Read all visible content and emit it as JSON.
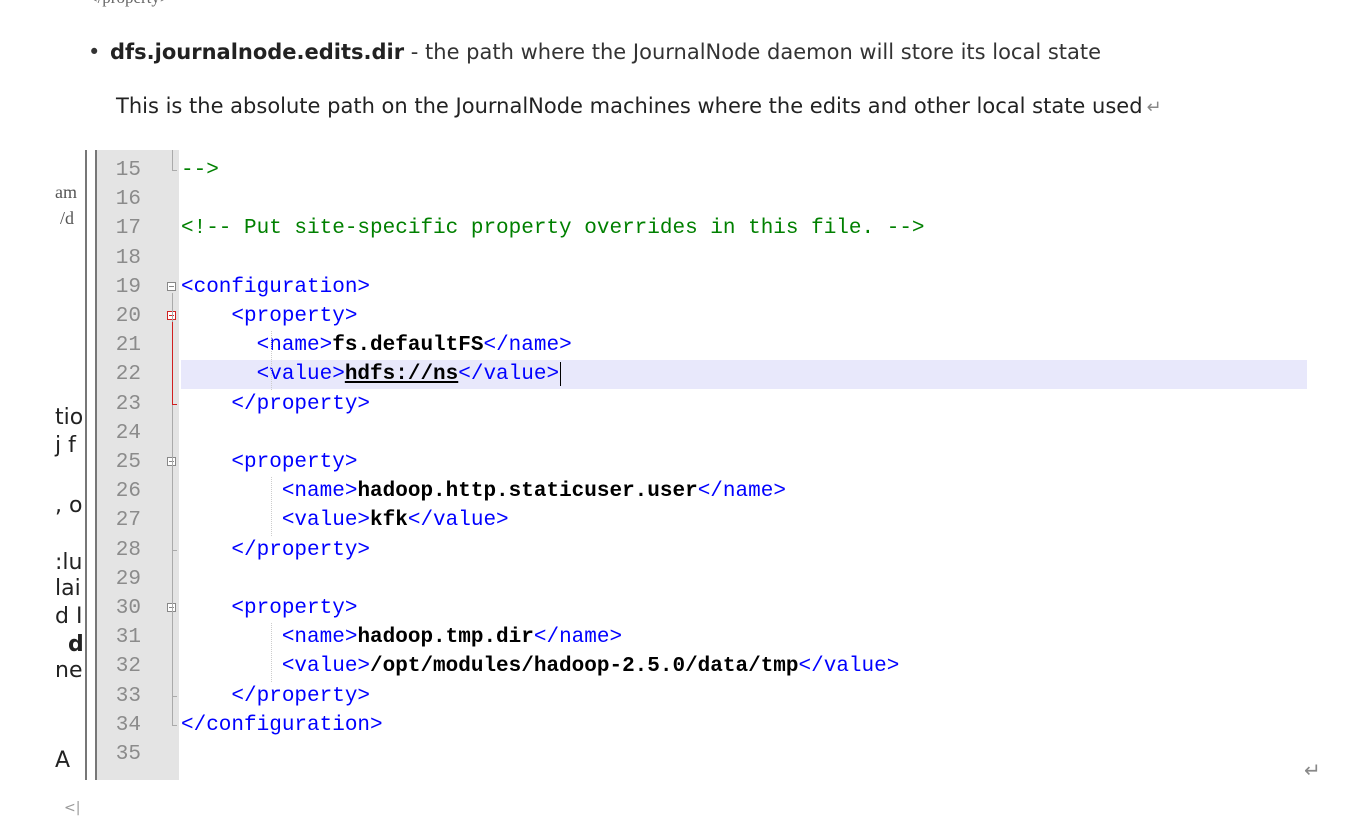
{
  "top_residue": "</property>",
  "bullet": {
    "term": "dfs.journalnode.edits.dir",
    "desc": " - the path where the JournalNode daemon will store its local state"
  },
  "paragraph": "This is the absolute path on the JournalNode machines where the edits and other local state used",
  "return_glyph": "↵",
  "clipped_left": [
    "am",
    "/d",
    "tio",
    "j f",
    ", o",
    ":lu",
    "lai",
    "d I",
    "d",
    "ne",
    "A"
  ],
  "editor": {
    "lines": [
      {
        "num": "15",
        "parts": [
          {
            "t": "-->",
            "c": "comment"
          }
        ]
      },
      {
        "num": "16",
        "parts": []
      },
      {
        "num": "17",
        "parts": [
          {
            "t": "<!-- Put site-specific property overrides in this file. -->",
            "c": "comment"
          }
        ]
      },
      {
        "num": "18",
        "parts": []
      },
      {
        "num": "19",
        "parts": [
          {
            "t": "<configuration>",
            "c": "tag"
          }
        ]
      },
      {
        "num": "20",
        "parts": [
          {
            "t": "    <property>",
            "c": "tag"
          }
        ]
      },
      {
        "num": "21",
        "parts": [
          {
            "t": "      <name>",
            "c": "tag"
          },
          {
            "t": "fs.defaultFS",
            "c": "tval"
          },
          {
            "t": "</name>",
            "c": "tag"
          }
        ]
      },
      {
        "num": "22",
        "parts": [
          {
            "t": "      <value>",
            "c": "tag"
          },
          {
            "t": "hdfs://ns",
            "c": "tval link"
          },
          {
            "t": "</value>",
            "c": "tag"
          }
        ]
      },
      {
        "num": "23",
        "parts": [
          {
            "t": "    </property>",
            "c": "tag"
          }
        ]
      },
      {
        "num": "24",
        "parts": []
      },
      {
        "num": "25",
        "parts": [
          {
            "t": "    <property>",
            "c": "tag"
          }
        ]
      },
      {
        "num": "26",
        "parts": [
          {
            "t": "        <name>",
            "c": "tag"
          },
          {
            "t": "hadoop.http.staticuser.user",
            "c": "tval"
          },
          {
            "t": "</name>",
            "c": "tag"
          }
        ]
      },
      {
        "num": "27",
        "parts": [
          {
            "t": "        <value>",
            "c": "tag"
          },
          {
            "t": "kfk",
            "c": "tval"
          },
          {
            "t": "</value>",
            "c": "tag"
          }
        ]
      },
      {
        "num": "28",
        "parts": [
          {
            "t": "    </property>",
            "c": "tag"
          }
        ]
      },
      {
        "num": "29",
        "parts": []
      },
      {
        "num": "30",
        "parts": [
          {
            "t": "    <property>",
            "c": "tag"
          }
        ]
      },
      {
        "num": "31",
        "parts": [
          {
            "t": "        <name>",
            "c": "tag"
          },
          {
            "t": "hadoop.tmp.dir",
            "c": "tval"
          },
          {
            "t": "</name>",
            "c": "tag"
          }
        ]
      },
      {
        "num": "32",
        "parts": [
          {
            "t": "        <value>",
            "c": "tag"
          },
          {
            "t": "/opt/modules/hadoop-2.5.0/data/tmp",
            "c": "tval"
          },
          {
            "t": "</value>",
            "c": "tag"
          }
        ]
      },
      {
        "num": "33",
        "parts": [
          {
            "t": "    </property>",
            "c": "tag"
          }
        ]
      },
      {
        "num": "34",
        "parts": [
          {
            "t": "</configuration>",
            "c": "tag"
          }
        ]
      },
      {
        "num": "35",
        "parts": []
      }
    ]
  }
}
